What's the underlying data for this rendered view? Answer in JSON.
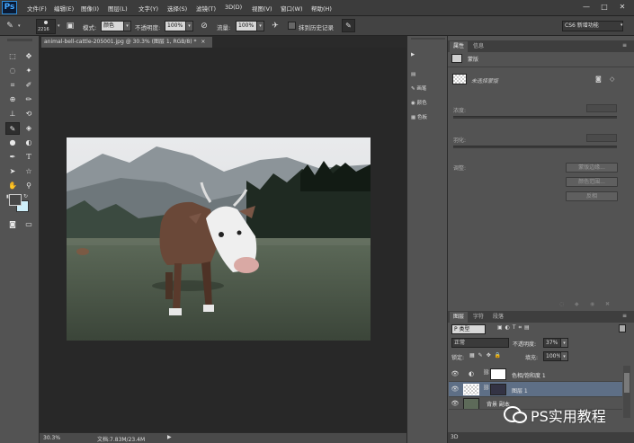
{
  "app": {
    "logo": "Ps"
  },
  "menu": [
    "文件(F)",
    "编辑(E)",
    "图像(I)",
    "图层(L)",
    "文字(Y)",
    "选择(S)",
    "滤镜(T)",
    "3D(D)",
    "视图(V)",
    "窗口(W)",
    "帮助(H)"
  ],
  "window_controls": {
    "minimize": "—",
    "restore": "□",
    "close": "✕"
  },
  "options": {
    "brush_size": "2216",
    "mode_label": "模式:",
    "mode_value": "颜色",
    "opacity_label": "不透明度:",
    "opacity_value": "100%",
    "flow_label": "流量:",
    "flow_value": "100%",
    "history_label": "抹到历史记录",
    "workspace": "CS6 新增功能"
  },
  "document": {
    "tab_title": "animal-bell-cattle-205001.jpg @ 30.3% (图层 1, RGB/8) *",
    "close": "×"
  },
  "status": {
    "zoom": "30.3%",
    "doc": "文档:7.83M/23.4M"
  },
  "mid_panel": {
    "items": [
      "",
      "",
      "画笔",
      "颜色",
      "色板"
    ]
  },
  "properties": {
    "tabs": [
      "属性",
      "信息"
    ],
    "section": "蒙版",
    "mask_label": "未选择蒙版",
    "density": "浓度:",
    "feather": "羽化:",
    "adjust": "调整:",
    "btn_mask_edge": "蒙版边缘...",
    "btn_color_range": "颜色范围...",
    "btn_invert": "反相"
  },
  "layers": {
    "tabs": [
      "图层",
      "字符",
      "段落"
    ],
    "filter": "P 类型",
    "blend": "正常",
    "opacity_label": "不透明度:",
    "opacity_value": "37%",
    "lock_label": "锁定:",
    "fill_label": "填充:",
    "fill_value": "100%",
    "items": [
      {
        "name": "色相/饱和度 1",
        "active": false
      },
      {
        "name": "图层 1",
        "active": true
      },
      {
        "name": "背景 副本",
        "active": false
      }
    ]
  },
  "panel_bottom": {
    "label": "3D"
  },
  "watermark": {
    "text": "PS实用教程"
  },
  "colors": {
    "accent": "#2f8cd8",
    "active_layer": "#5e6f86"
  }
}
